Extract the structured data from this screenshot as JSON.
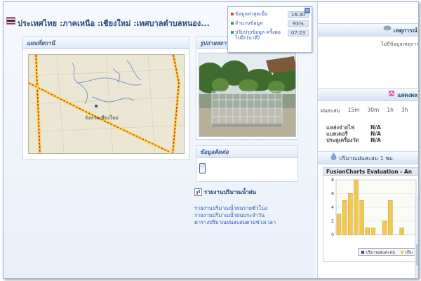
{
  "header": {
    "title": "ประเทศไทย :ภาคเหนือ :เชียงใหม่ :เทศบาลตำบลหนอง..."
  },
  "map_panel": {
    "title": "แผนที่สถานี",
    "map_label": "จังหวัดเชียงใหม่"
  },
  "photo_panel": {
    "title": "รูปถ่ายสถานี"
  },
  "contact_panel": {
    "title": "ข้อมูลติดต่อ"
  },
  "rain_report": {
    "title": "รายงานปริมาณน้ำฝน",
    "links": [
      "รายงานปริมาณน้ำฝนรายชั่วโมง",
      "รายงานปริมาณน้ำฝนประจำวัน",
      "ตารางปริมาณฝนสะสมตามช่วงเวลา"
    ]
  },
  "popup": {
    "close": "×",
    "rows": [
      {
        "label": "ข้อมูลล่าสุดเมื่อ",
        "value": "16:30",
        "color": "#e8442a"
      },
      {
        "label": "จำนวนข้อมูล",
        "value": "93%",
        "color": "#2aa84a"
      },
      {
        "label": "ปรับปรุงข้อมูล ครั้งต่อไปอีก(นาที)",
        "value": "07:23",
        "color": "#2a8fd6"
      }
    ]
  },
  "right_pane": {
    "events_title": "เหตุการณ์",
    "no_data": "ไม่มีข้อมูลเหตุการณ์",
    "status_title": "แสดงผล",
    "duration_label": "ฝนสะสม",
    "durations": [
      "15m",
      "30m",
      "1h",
      "3h"
    ],
    "status": [
      {
        "key": "แหล่งจ่ายไฟ",
        "value": "N/A"
      },
      {
        "key": "แบตเตอรี่",
        "value": "N/A"
      },
      {
        "key": "ประตูเครื่องวัด",
        "value": "N/A"
      }
    ],
    "rain_title": "ปริมาณฝนสะสม 1 ชม."
  },
  "chart_data": {
    "type": "bar",
    "title": "FusionCharts Evaluation - An",
    "ylim": [
      0,
      8
    ],
    "yticks": [
      0,
      2,
      4,
      6,
      8
    ],
    "values": [
      3,
      5,
      6,
      8,
      5,
      1,
      1,
      0,
      2,
      5,
      0,
      1,
      0,
      0
    ],
    "legend": [
      "ปริมาณฝนสะสม",
      "ปริม"
    ],
    "colors": {
      "bar": "#f2c94c",
      "bar_edge": "#a88a20",
      "legend_a": "#3a2ad6",
      "legend_b": "#f2c94c"
    }
  }
}
